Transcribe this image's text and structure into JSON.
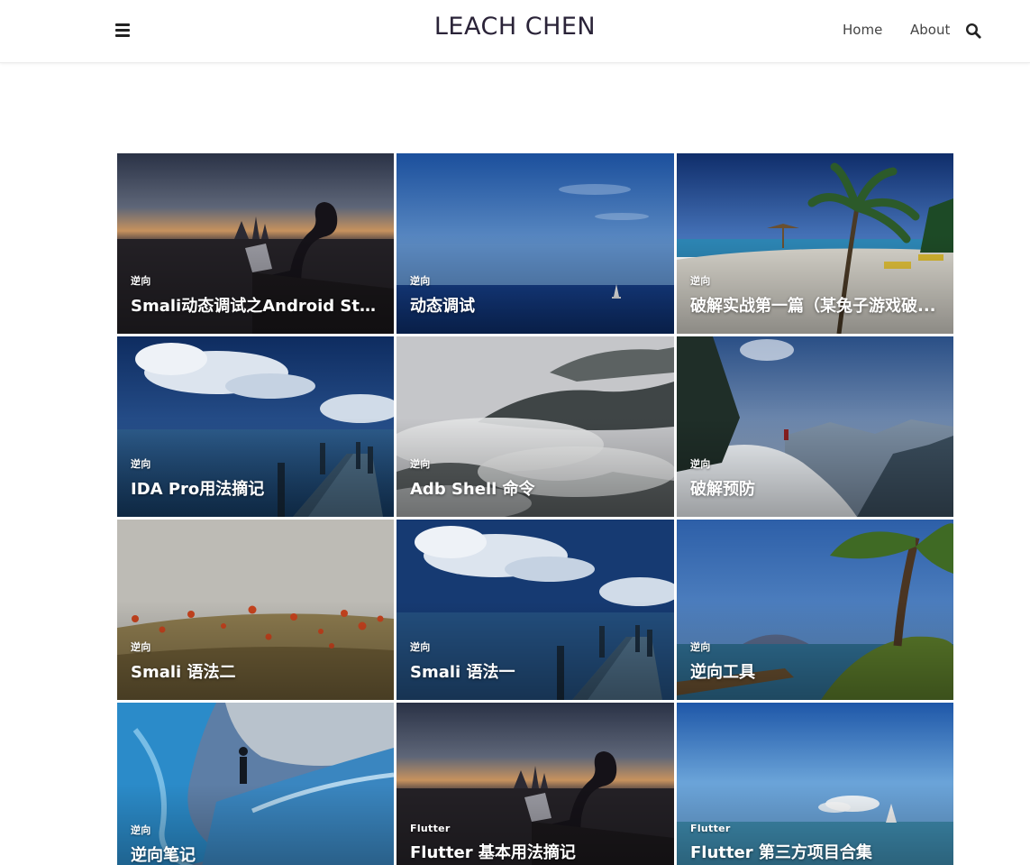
{
  "header": {
    "site_title": "LEACH CHEN",
    "nav": {
      "home": "Home",
      "about": "About"
    },
    "icons": {
      "menu": "menu-icon",
      "search": "search-icon"
    }
  },
  "posts": [
    {
      "category": "逆向",
      "title": "Smali动态调试之Android Stu...",
      "image": "city-laptop-silhouette"
    },
    {
      "category": "逆向",
      "title": "动态调试",
      "image": "blue-ocean-sailboat"
    },
    {
      "category": "逆向",
      "title": "破解实战第一篇（某兔子游戏破...",
      "image": "beach-palm-trees"
    },
    {
      "category": "逆向",
      "title": "IDA Pro用法摘记",
      "image": "pier-cloudy-sky"
    },
    {
      "category": "逆向",
      "title": "Adb Shell 命令",
      "image": "misty-forest-hills"
    },
    {
      "category": "逆向",
      "title": "破解预防",
      "image": "snowy-mountain-hiker"
    },
    {
      "category": "逆向",
      "title": "Smali 语法二",
      "image": "poppy-field"
    },
    {
      "category": "逆向",
      "title": "Smali 语法一",
      "image": "pier-cloudy-sky"
    },
    {
      "category": "逆向",
      "title": "逆向工具",
      "image": "island-tree-lake"
    },
    {
      "category": "逆向",
      "title": "逆向笔记",
      "image": "ice-cave-explorer"
    },
    {
      "category": "Flutter",
      "title": "Flutter 基本用法摘记",
      "image": "city-laptop-silhouette"
    },
    {
      "category": "Flutter",
      "title": "Flutter 第三方项目合集",
      "image": "blue-ocean-sailboat"
    }
  ]
}
